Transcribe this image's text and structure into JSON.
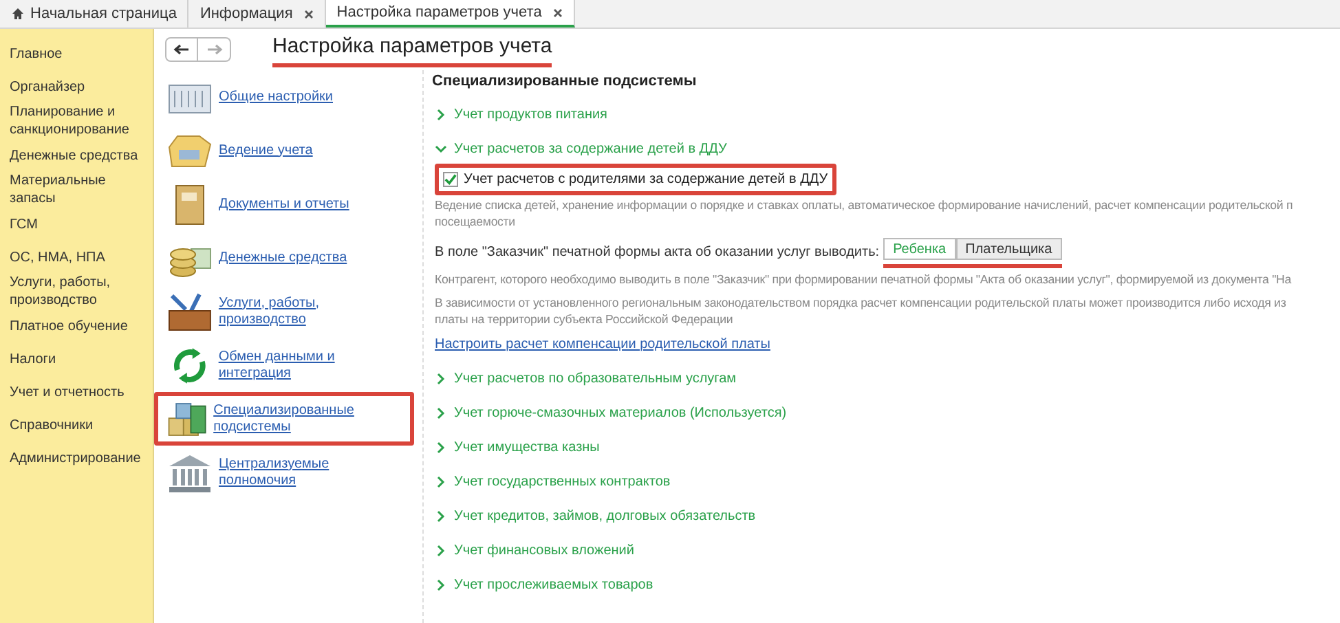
{
  "tabs": [
    {
      "label": "Начальная страница",
      "kind": "home",
      "selected": false
    },
    {
      "label": "Информация",
      "kind": "closable",
      "selected": false
    },
    {
      "label": "Настройка параметров учета",
      "kind": "closable",
      "selected": true
    }
  ],
  "sidebar": {
    "items": [
      {
        "label": "Главное"
      },
      {
        "label": "Органайзер"
      },
      {
        "label": "Планирование и санкционирование"
      },
      {
        "label": "Денежные средства"
      },
      {
        "label": "Материальные запасы"
      },
      {
        "label": "ГСМ"
      },
      {
        "label": "ОС, НМА, НПА"
      },
      {
        "label": "Услуги, работы, производство"
      },
      {
        "label": "Платное обучение"
      },
      {
        "label": "Налоги"
      },
      {
        "label": "Учет и отчетность"
      },
      {
        "label": "Справочники"
      },
      {
        "label": "Администрирование"
      }
    ]
  },
  "page": {
    "title": "Настройка параметров учета",
    "title_underlined": true
  },
  "nav": {
    "items": [
      {
        "label": "Общие настройки",
        "kind": "building",
        "highlighted": false
      },
      {
        "label": "Ведение учета",
        "kind": "folder",
        "highlighted": false
      },
      {
        "label": "Документы и отчеты",
        "kind": "book",
        "highlighted": false
      },
      {
        "label": "Денежные средства",
        "kind": "coins",
        "highlighted": false
      },
      {
        "label": "Услуги, работы, производство",
        "kind": "toolbox",
        "highlighted": false
      },
      {
        "label": "Обмен данными и интеграция",
        "kind": "sync",
        "highlighted": false
      },
      {
        "label": "Специализированные подсистемы",
        "kind": "blocks",
        "highlighted": true
      },
      {
        "label": "Централизуемые полномочия",
        "kind": "bank",
        "highlighted": false
      }
    ]
  },
  "content": {
    "heading": "Специализированные подсистемы",
    "sections": [
      {
        "label": "Учет продуктов питания",
        "expanded": false
      },
      {
        "label": "Учет расчетов за содержание детей в ДДУ",
        "expanded": true,
        "checkbox": {
          "label": "Учет расчетов с родителями за содержание детей в ДДУ",
          "checked": true,
          "highlighted": true
        },
        "description_lines": [
          "Ведение списка детей, хранение информации о порядке и ставках оплаты, автоматическое формирование начислений, расчет компенсации родительской п",
          "посещаемости"
        ],
        "choice": {
          "label": "В поле \"Заказчик\" печатной формы акта об оказании услуг выводить:",
          "underlined": true,
          "options": [
            {
              "label": "Ребенка",
              "selected": true
            },
            {
              "label": "Плательщика",
              "selected": false
            }
          ]
        },
        "hint": "Контрагент, которого необходимо выводить в поле \"Заказчик\" при формировании печатной формы \"Акта об оказании услуг\", формируемой из документа \"На",
        "note_lines": [
          "В зависимости от установленного региональным законодательством порядка расчет компенсации родительской платы может производится либо исходя из",
          "платы на территории субъекта Российской Федерации"
        ],
        "link": "Настроить расчет компенсации родительской платы"
      },
      {
        "label": "Учет расчетов по образовательным услугам",
        "expanded": false
      },
      {
        "label": "Учет горюче-смазочных материалов (Используется)",
        "expanded": false
      },
      {
        "label": "Учет имущества казны",
        "expanded": false
      },
      {
        "label": "Учет государственных контрактов",
        "expanded": false
      },
      {
        "label": "Учет кредитов, займов, долговых обязательств",
        "expanded": false
      },
      {
        "label": "Учет финансовых вложений",
        "expanded": false
      },
      {
        "label": "Учет прослеживаемых товаров",
        "expanded": false
      }
    ]
  }
}
